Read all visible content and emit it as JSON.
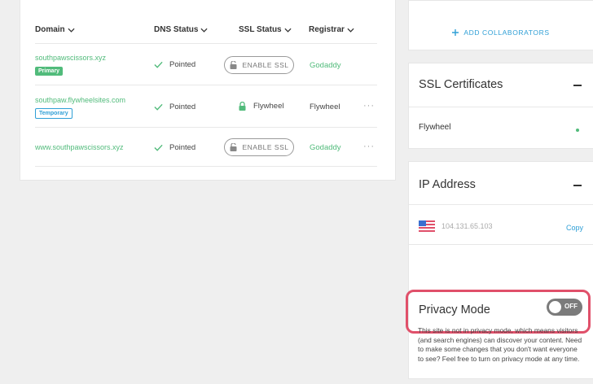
{
  "table": {
    "headers": {
      "domain": "Domain",
      "dns_status": "DNS Status",
      "ssl_status": "SSL Status",
      "registrar": "Registrar"
    },
    "rows": [
      {
        "domain": "southpawscissors.xyz",
        "badge": "Primary",
        "dns": "Pointed",
        "ssl": "ENABLE SSL",
        "registrar": "Godaddy"
      },
      {
        "domain": "southpaw.flywheelsites.com",
        "badge": "Temporary",
        "dns": "Pointed",
        "ssl": "Flywheel",
        "registrar": "Flywheel",
        "more": "···"
      },
      {
        "domain": "www.southpawscissors.xyz",
        "dns": "Pointed",
        "ssl": "ENABLE SSL",
        "registrar": "Godaddy",
        "more": "···"
      }
    ]
  },
  "collaborators": {
    "add_label": "ADD COLLABORATORS"
  },
  "ssl_certificates": {
    "title": "SSL Certificates",
    "provider": "Flywheel"
  },
  "ip_address": {
    "title": "IP Address",
    "value": "104.131.65.103",
    "copy_label": "Copy"
  },
  "privacy": {
    "title": "Privacy Mode",
    "toggle_state": "OFF",
    "description": "This site is not in privacy mode, which means visitors (and search engines) can discover your content. Need to make some changes that you don't want everyone to see? Feel free to turn on privacy mode at any time."
  },
  "colors": {
    "accent_green": "#51bb7b",
    "accent_blue": "#2f9fd6",
    "highlight_red": "#e0506a"
  }
}
